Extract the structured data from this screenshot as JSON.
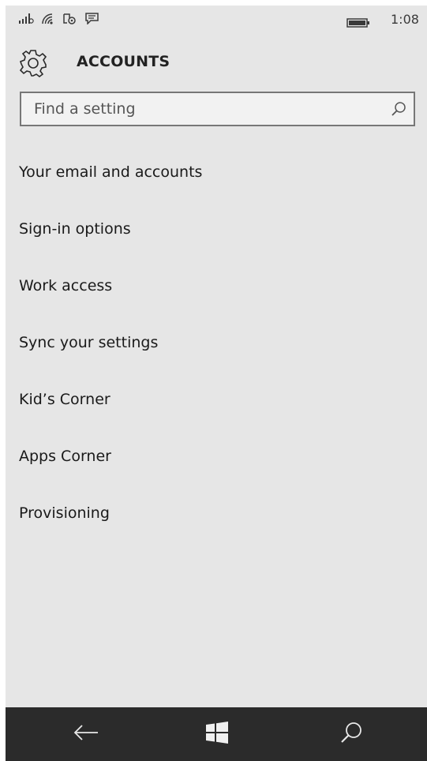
{
  "status_bar": {
    "icons": [
      "signal-icon",
      "wifi-icon",
      "location-icon",
      "message-icon",
      "battery-icon"
    ],
    "time": "1:08"
  },
  "header": {
    "icon": "gear-icon",
    "title": "ACCOUNTS"
  },
  "search": {
    "placeholder": "Find a setting",
    "value": "",
    "icon": "search-icon"
  },
  "menu": {
    "items": [
      {
        "label": "Your email and accounts"
      },
      {
        "label": "Sign-in options"
      },
      {
        "label": "Work access"
      },
      {
        "label": "Sync your settings"
      },
      {
        "label": "Kid’s Corner"
      },
      {
        "label": "Apps Corner"
      },
      {
        "label": "Provisioning"
      }
    ]
  },
  "nav_bar": {
    "icons": [
      "back-arrow-icon",
      "windows-start-icon",
      "search-icon"
    ]
  },
  "colors": {
    "background": "#e6e6e6",
    "nav_bar": "#2b2b2b",
    "text": "#1a1a1a"
  }
}
